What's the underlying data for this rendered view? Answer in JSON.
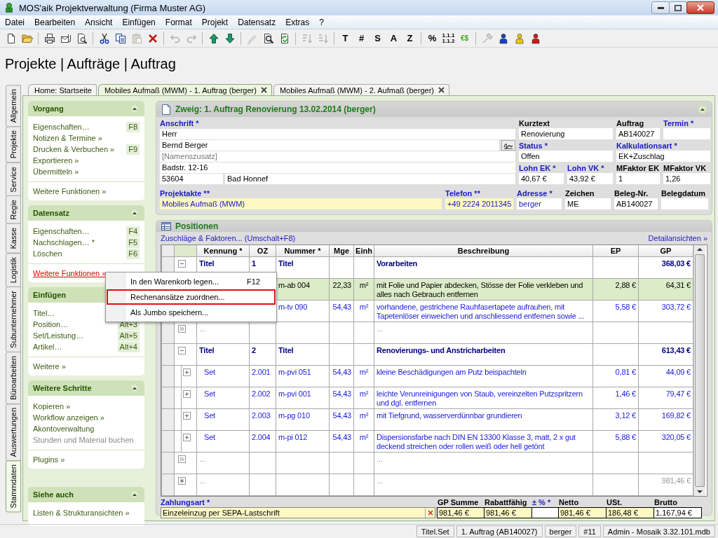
{
  "window": {
    "title": "MOS'aik Projektverwaltung (Firma Muster AG)"
  },
  "menu": [
    "Datei",
    "Bearbeiten",
    "Ansicht",
    "Einfügen",
    "Format",
    "Projekt",
    "Datensatz",
    "Extras",
    "?"
  ],
  "toolbar": [
    {
      "kind": "new",
      "disabled": false
    },
    {
      "kind": "open",
      "disabled": false
    },
    {
      "kind": "separator"
    },
    {
      "kind": "print",
      "disabled": false
    },
    {
      "kind": "mail",
      "disabled": false
    },
    {
      "kind": "preview",
      "disabled": false
    },
    {
      "kind": "separator"
    },
    {
      "kind": "cut",
      "disabled": false
    },
    {
      "kind": "copy",
      "disabled": false
    },
    {
      "kind": "paste",
      "disabled": true
    },
    {
      "kind": "delete",
      "disabled": false
    },
    {
      "kind": "separator"
    },
    {
      "kind": "undo",
      "disabled": true
    },
    {
      "kind": "redo",
      "disabled": true
    },
    {
      "kind": "separator"
    },
    {
      "kind": "up",
      "disabled": false
    },
    {
      "kind": "down",
      "disabled": false
    },
    {
      "kind": "separator"
    },
    {
      "kind": "edit",
      "disabled": true
    },
    {
      "kind": "find",
      "disabled": false
    },
    {
      "kind": "refresh",
      "disabled": false
    },
    {
      "kind": "separator"
    },
    {
      "kind": "sort-asc",
      "disabled": true
    },
    {
      "kind": "sort-desc",
      "disabled": true
    },
    {
      "kind": "separator"
    },
    {
      "kind": "text",
      "label": "T",
      "disabled": false
    },
    {
      "kind": "text",
      "label": "#",
      "disabled": false
    },
    {
      "kind": "text",
      "label": "S",
      "disabled": false
    },
    {
      "kind": "text",
      "label": "A",
      "disabled": false
    },
    {
      "kind": "text",
      "label": "Z",
      "disabled": false
    },
    {
      "kind": "separator"
    },
    {
      "kind": "text",
      "label": "%",
      "disabled": false
    },
    {
      "kind": "stacked",
      "lines": [
        "1.1.1",
        "1.1.2"
      ],
      "disabled": false
    },
    {
      "kind": "small-text",
      "label": "€$",
      "disabled": false
    },
    {
      "kind": "separator"
    },
    {
      "kind": "tool",
      "disabled": true
    },
    {
      "kind": "person",
      "color": "#1a3fbf",
      "disabled": false
    },
    {
      "kind": "person",
      "color": "#e8c800",
      "disabled": false
    },
    {
      "kind": "person",
      "color": "#d01818",
      "disabled": false
    }
  ],
  "breadcrumb": "Projekte | Aufträge | Auftrag",
  "side_tabs": [
    {
      "label": "Allgemein",
      "selected": false
    },
    {
      "label": "Projekte",
      "selected": false
    },
    {
      "label": "Service",
      "selected": false
    },
    {
      "label": "Regie",
      "selected": false
    },
    {
      "label": "Kasse",
      "selected": false
    },
    {
      "label": "Logistik",
      "selected": false
    },
    {
      "label": "Subunternehmer",
      "selected": false
    },
    {
      "label": "Büroarbeiten",
      "selected": false
    },
    {
      "label": "Auswertungen",
      "selected": false
    },
    {
      "label": "Stammdaten",
      "selected": true
    }
  ],
  "doc_tabs": [
    {
      "label": "Home: Startseite",
      "selected": false,
      "closable": false
    },
    {
      "label": "Mobiles Aufmaß (MWM) - 1. Auftrag (berger)",
      "selected": true,
      "closable": true
    },
    {
      "label": "Mobiles Aufmaß (MWM) - 2. Aufmaß (berger)",
      "selected": false,
      "closable": true
    }
  ],
  "task_pane": [
    {
      "title": "Vorgang",
      "expanded": true,
      "items": [
        {
          "label": "Eigenschaften…",
          "shortcut": "F8",
          "disabled": false
        },
        {
          "label": "Notizen & Termine »",
          "disabled": false
        },
        {
          "label": "Drucken & Verbuchen »",
          "shortcut": "F9",
          "disabled": false
        },
        {
          "label": "Exportieren »",
          "disabled": false
        },
        {
          "label": "Übermitteln »",
          "disabled": false
        }
      ],
      "footer": [
        {
          "label": "Weitere Funktionen »",
          "hovered": false
        }
      ]
    },
    {
      "title": "Datensatz",
      "expanded": true,
      "items": [
        {
          "label": "Eigenschaften…",
          "shortcut": "F4",
          "disabled": false
        },
        {
          "label": "Nachschlagen… *",
          "shortcut": "F5",
          "disabled": false
        },
        {
          "label": "Löschen",
          "shortcut": "F6",
          "disabled": false
        }
      ],
      "footer": [
        {
          "label": "Weitere Funktionen »",
          "hovered": true
        }
      ]
    },
    {
      "title": "Einfügen",
      "expanded": true,
      "items": [
        {
          "label": "Titel…",
          "disabled": false
        },
        {
          "label": "Position…",
          "shortcut": "Alt+3",
          "disabled": false
        },
        {
          "label": "Set/Leistung…",
          "shortcut": "Alt+5",
          "disabled": false
        },
        {
          "label": "Artikel…",
          "shortcut": "Alt+4",
          "disabled": false
        }
      ],
      "footer": [
        {
          "label": "Weitere »",
          "hovered": false
        }
      ]
    },
    {
      "title": "Weitere Schritte",
      "expanded": true,
      "items": [
        {
          "label": "Kopieren »",
          "disabled": false
        },
        {
          "label": "Workflow anzeigen »",
          "disabled": false
        },
        {
          "label": "Akontoverwaltung",
          "disabled": false
        },
        {
          "label": "Stunden und Material buchen",
          "disabled": true
        }
      ],
      "footer": [
        {
          "label": "Plugins »",
          "hovered": false
        }
      ]
    },
    {
      "title": "Siehe auch",
      "expanded": true,
      "items": [
        {
          "label": "Listen & Strukturansichten »",
          "disabled": false
        }
      ]
    }
  ],
  "form": {
    "title": "Zweig: 1. Auftrag Renovierung 13.02.2014 (berger)",
    "expanded": true,
    "address": {
      "label": "Anschrift *",
      "required": true,
      "lines": [
        {
          "kind": "plain",
          "value": "Herr"
        },
        {
          "kind": "with-button",
          "value": "Bernd Berger"
        },
        {
          "kind": "plain",
          "placeholder": "[Namenszusatz]"
        },
        {
          "kind": "plain",
          "value": "Badstr. 12-16"
        },
        {
          "kind": "postal",
          "values": [
            "53604",
            "Bad Honnef"
          ]
        }
      ]
    },
    "right_rows": [
      [
        {
          "label": "Kurztext",
          "required": false,
          "value": "Renovierung"
        },
        {
          "label": "Auftrag",
          "required": false,
          "value": "AB140027"
        },
        {
          "label": "Termin *",
          "required": true
        }
      ],
      [
        {
          "label": "Status *",
          "required": true,
          "value": "Offen"
        },
        {
          "label": "Kalkulationsart *",
          "required": true,
          "value": "EK+Zuschlag"
        }
      ],
      [
        {
          "label": "Lohn EK *",
          "required": true,
          "value": "40,67 €"
        },
        {
          "label": "Lohn VK *",
          "required": true,
          "value": "43,92 €"
        },
        {
          "label": "MFaktor EK",
          "required": false,
          "value": "1"
        },
        {
          "label": "MFaktor VK",
          "required": false,
          "value": "1,26"
        }
      ]
    ],
    "bottom_fields": [
      {
        "label": "Projektakte **",
        "required": true,
        "kind": "lookup",
        "value": "Mobiles Aufmaß (MWM)"
      },
      {
        "label": "Telefon **",
        "required": true,
        "kind": "lookup",
        "value": "+49 2224 2011345"
      },
      {
        "label": "Adresse *",
        "required": true,
        "kind": "link",
        "value": "berger"
      },
      {
        "label": "Zeichen",
        "required": false,
        "kind": "plain",
        "value": "ME"
      },
      {
        "label": "Beleg-Nr.",
        "required": false,
        "kind": "plain",
        "value": "AB140027"
      },
      {
        "label": "Belegdatum",
        "required": false,
        "kind": "plain"
      }
    ]
  },
  "positions": {
    "title": "Positionen",
    "links": [
      "Zuschläge & Faktoren... (Umschalt+F8)",
      "Detailansichten »"
    ],
    "columns": [
      "Kennung *",
      "OZ",
      "Nummer *",
      "Mge",
      "Einh",
      "Beschreibung",
      "EP",
      "GP"
    ],
    "rows": [
      {
        "kind": "title",
        "selected": false,
        "expanded": true,
        "kennung": "Titel",
        "oz": "1",
        "nummer": "Titel",
        "beschreibung": "Vorarbeiten",
        "gp": "368,03 €"
      },
      {
        "kind": "item",
        "selected": true,
        "nummer": "m-ab 004",
        "mge": "22,33",
        "einh": "m²",
        "beschreibung": "mit Folie und Papier abdecken, Stösse der Folie verkleben und alles nach Gebrauch entfernen",
        "ep": "2,88 €",
        "gp": "64,31 €"
      },
      {
        "kind": "item",
        "selected": false,
        "nummer": "m-tv 090",
        "mge": "54,43",
        "einh": "m²",
        "beschreibung": "vorhandene, gestrichene Rauhfasertapete aufrauhen, mit Tapetenlöser einweichen und anschliessend entfernen sowie ...",
        "ep": "5,58 €",
        "gp": "303,72 €"
      },
      {
        "kind": "empty",
        "selected": false,
        "kennung": "...",
        "beschreibung": "..."
      },
      {
        "kind": "title",
        "selected": false,
        "expanded": true,
        "kennung": "Titel",
        "oz": "2",
        "nummer": "Titel",
        "beschreibung": "Renovierungs- und Anstricharbeiten",
        "gp": "613,43 €"
      },
      {
        "kind": "set",
        "selected": false,
        "expanded": false,
        "kennung": "Set",
        "oz": "2.001",
        "nummer": "m-pvi 051",
        "mge": "54,43",
        "einh": "m²",
        "beschreibung": "kleine Beschädigungen am Putz beispachteln",
        "ep": "0,81 €",
        "gp": "44,09 €"
      },
      {
        "kind": "set",
        "selected": false,
        "expanded": false,
        "kennung": "Set",
        "oz": "2.002",
        "nummer": "m-pvi 001",
        "mge": "54,43",
        "einh": "m²",
        "beschreibung": "leichte Verunreinigungen von Staub, vereinzelten Putzspritzern und dgl. entfernen",
        "ep": "1,46 €",
        "gp": "79,47 €"
      },
      {
        "kind": "set",
        "selected": false,
        "expanded": false,
        "kennung": "Set",
        "oz": "2.003",
        "nummer": "m-pg 010",
        "mge": "54,43",
        "einh": "m²",
        "beschreibung": "mit Tiefgrund, wasserverdünnbar grundieren",
        "ep": "3,12 €",
        "gp": "169,82 €"
      },
      {
        "kind": "set",
        "selected": false,
        "expanded": false,
        "kennung": "Set",
        "oz": "2.004",
        "nummer": "m-pi 012",
        "mge": "54,43",
        "einh": "m²",
        "beschreibung": "Dispersionsfarbe nach DIN EN 13300 Klasse 3, matt, 2 x gut deckend streichen oder rollen weiß oder hell getönt",
        "ep": "5,88 €",
        "gp": "320,05 €"
      },
      {
        "kind": "empty",
        "selected": false,
        "kennung": "...",
        "beschreibung": "..."
      },
      {
        "kind": "sum",
        "selected": false,
        "kennung": "...",
        "beschreibung": "...",
        "gp": "981,46 €"
      }
    ],
    "payment": {
      "label": "Zahlungsart *",
      "value": "Einzeleinzug per SEPA-Lastschrift"
    },
    "totals": [
      {
        "label": "GP Summe",
        "required": false,
        "readonly": true,
        "value": "981,46 €"
      },
      {
        "label": "Rabattfähig",
        "required": false,
        "readonly": true,
        "value": "981,46 €"
      },
      {
        "label": "± % *",
        "required": true,
        "readonly": false
      },
      {
        "label": "Netto",
        "required": false,
        "readonly": true,
        "value": "981,46 €"
      },
      {
        "label": "USt.",
        "required": false,
        "readonly": true,
        "value": "186,48 €"
      },
      {
        "label": "Brutto",
        "required": false,
        "readonly": false,
        "value": "1.167,94 €"
      }
    ]
  },
  "context_menu": [
    {
      "label": "In den Warenkorb legen...",
      "shortcut": "F12",
      "highlighted": false
    },
    {
      "label": "Rechenansätze zuordnen...",
      "highlighted": true
    },
    {
      "label": "Als Jumbo speichern...",
      "highlighted": false
    }
  ],
  "status_bar": [
    "Titel.Set",
    "1. Auftrag (AB140027)",
    "berger",
    "#11",
    "Admin - Mosaik 3.32.101.mdb"
  ]
}
